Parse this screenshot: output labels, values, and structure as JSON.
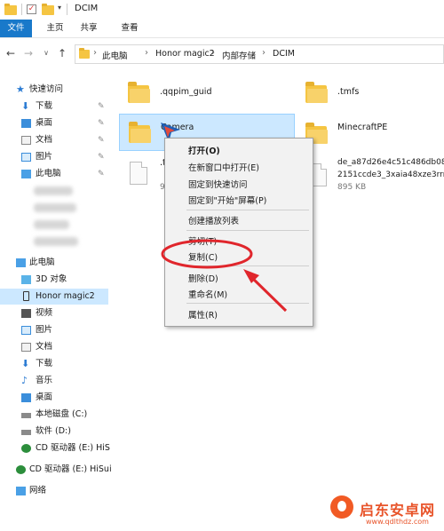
{
  "window": {
    "title": "DCIM"
  },
  "ribbon": {
    "tabs": [
      "文件",
      "主页",
      "共享",
      "查看"
    ]
  },
  "address": {
    "crumbs": [
      "此电脑",
      "Honor magic2",
      "内部存储",
      "DCIM"
    ]
  },
  "nav": {
    "quick_access": "快速访问",
    "quick_items": [
      "下载",
      "桌面",
      "文档",
      "图片",
      "此电脑"
    ],
    "this_pc": "此电脑",
    "pc_items": [
      "3D 对象",
      "Honor magic2",
      "视频",
      "图片",
      "文档",
      "下载",
      "音乐",
      "桌面",
      "本地磁盘 (C:)",
      "软件 (D:)",
      "CD 驱动器 (E:) HiS"
    ],
    "cd_drive": "CD 驱动器 (E:) HiSui",
    "network": "网络"
  },
  "files": {
    "qqpim": ".qqpim_guid",
    "tmfs": ".tmfs",
    "camera": "Camera",
    "minecraft": "MinecraftPE",
    "doc_left_name_partial": ".t",
    "doc_left_size_partial": "9",
    "doc_right_line1": "de_a87d26e4c51c486db08",
    "doc_right_line2": "2151ccde3_3xaia48xze3rrn",
    "doc_right_size": "895 KB"
  },
  "context_menu": {
    "open": "打开(O)",
    "open_new_window": "在新窗口中打开(E)",
    "pin_quick": "固定到快速访问",
    "pin_start": "固定到\"开始\"屏幕(P)",
    "create_playlist": "创建播放列表",
    "cut": "剪切(T)",
    "copy": "复制(C)",
    "delete": "删除(D)",
    "rename": "重命名(M)",
    "properties": "属性(R)"
  },
  "watermark": {
    "title": "启东安卓网",
    "url": "www.qdlthdz.com"
  },
  "colors": {
    "accent": "#1979ca",
    "annotation": "#e0262c",
    "folder": "#f5c542",
    "selection": "#cce8ff"
  }
}
